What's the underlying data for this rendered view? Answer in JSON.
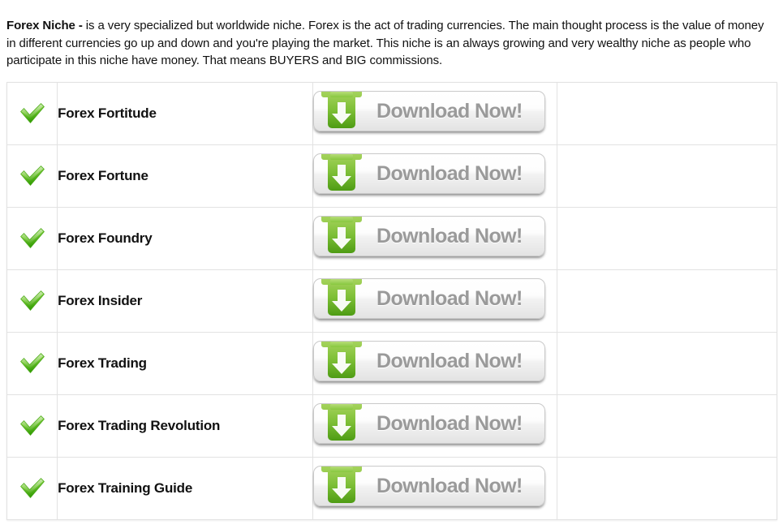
{
  "intro": {
    "lead": "Forex Niche -",
    "body": " is a very specialized but worldwide niche. Forex is the act of trading currencies. The main thought process is the value of money in different currencies go up and down and you're playing the market. This niche is an always growing and very wealthy niche as people who participate in this niche have money. That means BUYERS and BIG commissions."
  },
  "colors": {
    "check_green_light": "#8dd14b",
    "check_green_dark": "#36a400",
    "button_green_light": "#8cc63f",
    "button_green_dark": "#4a9e19",
    "button_text_gray": "#9a9a9a",
    "table_border": "#e2e2e2"
  },
  "table": {
    "icons": {
      "check": "green-check-icon",
      "download": "download-arrow-icon"
    },
    "action_label": "Download Now!",
    "rows": [
      {
        "check": "✓",
        "title": "Forex Fortitude",
        "action": "Download Now!"
      },
      {
        "check": "✓",
        "title": "Forex Fortune",
        "action": "Download Now!"
      },
      {
        "check": "✓",
        "title": "Forex Foundry",
        "action": "Download Now!"
      },
      {
        "check": "✓",
        "title": "Forex Insider",
        "action": "Download Now!"
      },
      {
        "check": "✓",
        "title": "Forex Trading",
        "action": "Download Now!"
      },
      {
        "check": "✓",
        "title": "Forex Trading Revolution",
        "action": "Download Now!"
      },
      {
        "check": "✓",
        "title": "Forex Training Guide",
        "action": "Download Now!"
      }
    ]
  }
}
